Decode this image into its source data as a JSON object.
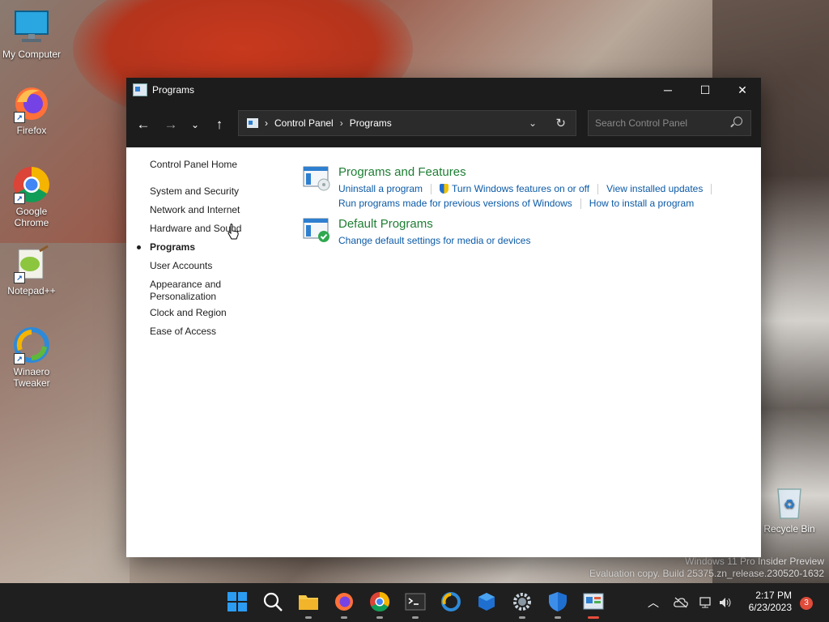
{
  "desktop": {
    "icons": [
      {
        "label": "My Computer"
      },
      {
        "label": "Firefox"
      },
      {
        "label": "Google Chrome"
      },
      {
        "label": "Notepad++"
      },
      {
        "label": "Winaero Tweaker"
      },
      {
        "label": "Recycle Bin"
      }
    ],
    "watermark": {
      "line1": "Windows 11 Pro Insider Preview",
      "line2": "Evaluation copy. Build 25375.zn_release.230520-1632"
    }
  },
  "window": {
    "title": "Programs",
    "controls": {
      "minimize": "─",
      "maximize": "☐",
      "close": "✕"
    },
    "address": {
      "crumbs": [
        "Control Panel",
        "Programs"
      ],
      "separator": "›"
    },
    "search": {
      "placeholder": "Search Control Panel"
    },
    "left_nav": {
      "home": "Control Panel Home",
      "items": [
        {
          "label": "System and Security"
        },
        {
          "label": "Network and Internet"
        },
        {
          "label": "Hardware and Sound"
        },
        {
          "label": "Programs",
          "active": true
        },
        {
          "label": "User Accounts"
        },
        {
          "label": "Appearance and Personalization"
        },
        {
          "label": "Clock and Region"
        },
        {
          "label": "Ease of Access"
        }
      ]
    },
    "categories": [
      {
        "title": "Programs and Features",
        "links": [
          "Uninstall a program",
          "Turn Windows features on or off",
          "View installed updates",
          "Run programs made for previous versions of Windows",
          "How to install a program"
        ]
      },
      {
        "title": "Default Programs",
        "links": [
          "Change default settings for media or devices"
        ]
      }
    ]
  },
  "taskbar": {
    "clock": {
      "time": "2:17 PM",
      "date": "6/23/2023"
    },
    "notification_count": "3",
    "apps": [
      "start-icon",
      "search-icon",
      "file-explorer-icon",
      "firefox-icon",
      "chrome-icon",
      "terminal-icon",
      "winaero-icon",
      "cube-app-icon",
      "settings-icon",
      "defender-icon",
      "control-panel-icon"
    ]
  },
  "colors": {
    "link": "#0b5aa6",
    "category_title": "#1e7e34",
    "titlebar": "#1c1c1c",
    "taskbar": "#1f1f1f"
  }
}
